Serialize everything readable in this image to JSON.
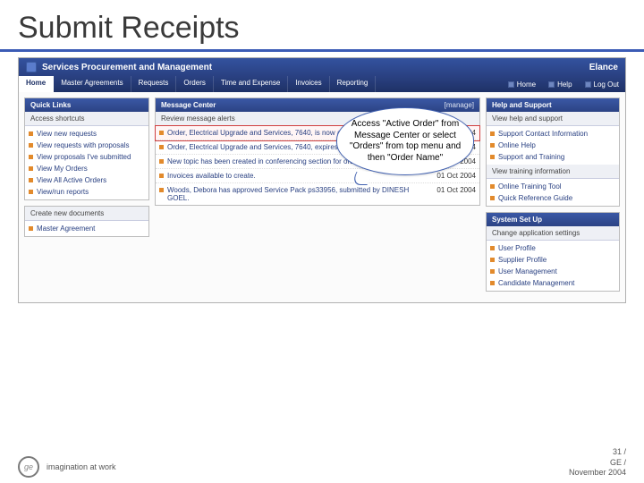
{
  "slide": {
    "title": "Submit Receipts"
  },
  "app": {
    "title": "Services Procurement and Management",
    "brand": "Elance"
  },
  "nav": {
    "tabs": [
      "Home",
      "Master Agreements",
      "Requests",
      "Orders",
      "Time and Expense",
      "Invoices",
      "Reporting"
    ],
    "utils": {
      "home": "Home",
      "help": "Help",
      "logout": "Log Out"
    }
  },
  "quick_links": {
    "header": "Quick Links",
    "sub": "Access shortcuts",
    "items": [
      "View new requests",
      "View requests with proposals",
      "View proposals I've submitted",
      "View My Orders",
      "View All Active Orders",
      "View/run reports"
    ]
  },
  "create_docs": {
    "header": "Create new documents",
    "items": [
      "Master Agreement"
    ]
  },
  "message_center": {
    "header": "Message Center",
    "manage": "[manage]",
    "sub": "Review message alerts",
    "messages": [
      {
        "text": "Order, Electrical Upgrade and Services, 7640, is now active.",
        "date": "01 Oct 2004",
        "highlight": true
      },
      {
        "text": "Order, Electrical Upgrade and Services, 7640, expires in 10 days.",
        "date": "01 Oct 2004"
      },
      {
        "text": "New topic has been created in conferencing section for order, 7340",
        "date": "01 Oct 2004"
      },
      {
        "text": "Invoices available to create.",
        "date": "01 Oct 2004"
      },
      {
        "text": "Woods, Debora has approved Service Pack ps33956, submitted by DINESH GOEL.",
        "date": "01 Oct 2004"
      }
    ]
  },
  "help_support": {
    "header": "Help and Support",
    "sub": "View help and support",
    "items": [
      "Support Contact Information",
      "Online Help",
      "Support and Training"
    ]
  },
  "training": {
    "sub": "View training information",
    "items": [
      "Online Training Tool",
      "Quick Reference Guide"
    ]
  },
  "system_setup": {
    "header": "System Set Up",
    "sub": "Change application settings",
    "items": [
      "User Profile",
      "Supplier Profile",
      "User Management",
      "Candidate Management"
    ]
  },
  "callout": {
    "text": "Access \"Active Order\" from Message Center or select \"Orders\" from top menu and then \"Order Name\""
  },
  "footer": {
    "tagline": "imagination at work",
    "page": "31 /",
    "company": "GE /",
    "date": "November 2004"
  }
}
